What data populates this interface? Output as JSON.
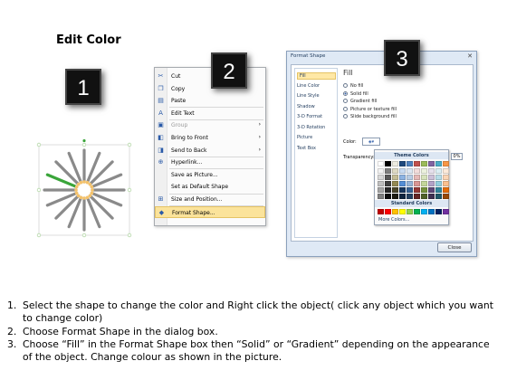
{
  "title": "Edit Color",
  "badges": [
    "1",
    "2",
    "3"
  ],
  "context_menu": {
    "items": [
      {
        "label": "Cut",
        "icon": "scissors-icon",
        "glyph": "✂"
      },
      {
        "label": "Copy",
        "icon": "copy-icon",
        "glyph": "❐"
      },
      {
        "label": "Paste",
        "icon": "paste-icon",
        "glyph": "▤"
      },
      {
        "label": "Edit Text",
        "icon": "edit-text-icon",
        "glyph": "A"
      },
      {
        "label": "Group",
        "icon": "group-icon",
        "glyph": "▣",
        "submenu": true,
        "disabled": true
      },
      {
        "label": "Bring to Front",
        "icon": "bring-to-front-icon",
        "glyph": "◧",
        "submenu": true
      },
      {
        "label": "Send to Back",
        "icon": "send-to-back-icon",
        "glyph": "◨",
        "submenu": true
      },
      {
        "label": "Hyperlink...",
        "icon": "hyperlink-icon",
        "glyph": "⊕"
      },
      {
        "label": "Save as Picture...",
        "icon": "",
        "glyph": ""
      },
      {
        "label": "Set as Default Shape",
        "icon": "",
        "glyph": ""
      },
      {
        "label": "Size and Position...",
        "icon": "size-position-icon",
        "glyph": "⊞"
      },
      {
        "label": "Format Shape...",
        "icon": "format-shape-icon",
        "glyph": "◆",
        "highlight": true
      }
    ]
  },
  "dialog": {
    "title": "Format Shape",
    "close_glyph": "✕",
    "nav": [
      "Fill",
      "Line Color",
      "Line Style",
      "Shadow",
      "3-D Format",
      "3-D Rotation",
      "Picture",
      "Text Box"
    ],
    "section_title": "Fill",
    "options": [
      "No fill",
      "Solid fill",
      "Gradient fill",
      "Picture or texture fill",
      "Slide background fill"
    ],
    "selected_option": "Solid fill",
    "color_label": "Color:",
    "color_button_glyph": "▾",
    "transparency_label": "Transparency:",
    "transparency_value": "0%",
    "palette": {
      "theme_title": "Theme Colors",
      "standard_title": "Standard Colors",
      "more_colors": "More Colors...",
      "theme_row": [
        "#ffffff",
        "#000000",
        "#eeece1",
        "#1f497d",
        "#4f81bd",
        "#c0504d",
        "#9bbb59",
        "#8064a2",
        "#4bacc6",
        "#f79646"
      ],
      "theme_tints": [
        [
          "#f2f2f2",
          "#7f7f7f",
          "#ddd9c3",
          "#c6d9f0",
          "#dbe5f1",
          "#f2dcdb",
          "#ebf1dd",
          "#e5e0ec",
          "#dbeef3",
          "#fdeada"
        ],
        [
          "#d8d8d8",
          "#595959",
          "#c4bd97",
          "#8db3e2",
          "#b8cce4",
          "#e5b9b7",
          "#d7e3bc",
          "#ccc1d9",
          "#b7dde8",
          "#fbd5b5"
        ],
        [
          "#bfbfbf",
          "#3f3f3f",
          "#938953",
          "#548dd4",
          "#95b3d7",
          "#d99694",
          "#c3d69b",
          "#b2a2c7",
          "#92cddc",
          "#fac08f"
        ],
        [
          "#a5a5a5",
          "#262626",
          "#494429",
          "#17365d",
          "#366092",
          "#953734",
          "#76923c",
          "#5f497a",
          "#31859b",
          "#e36c09"
        ],
        [
          "#7f7f7f",
          "#0c0c0c",
          "#1d1b10",
          "#0f243e",
          "#244061",
          "#632423",
          "#4f6128",
          "#3f3151",
          "#205867",
          "#974806"
        ]
      ],
      "standard_row": [
        "#c00000",
        "#ff0000",
        "#ffc000",
        "#ffff00",
        "#92d050",
        "#00b050",
        "#00b0f0",
        "#0070c0",
        "#002060",
        "#7030a0"
      ]
    },
    "close_button": "Close"
  },
  "instructions": [
    {
      "num": "1.",
      "text": "Select the shape to change the color and Right click the object( click any object which you want to change color)"
    },
    {
      "num": "2.",
      "text": "Choose Format Shape in the dialog box."
    },
    {
      "num": "3.",
      "text": "Choose “Fill” in the Format Shape box then “Solid” or “Gradient” depending on the appearance of the object. Change colour as shown in the picture."
    }
  ],
  "colors": {
    "spoke_gray": "#8a8a8a",
    "spoke_highlight": "#3aa53a",
    "selection_handle": "#b5d8a8",
    "badge_bg": "#111111"
  },
  "shape": {
    "spoke_count": 16,
    "selected_spoke": 13
  }
}
